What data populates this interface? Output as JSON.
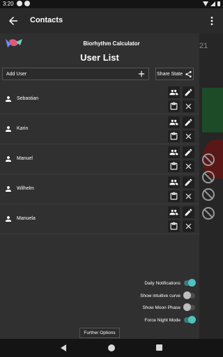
{
  "status_bar": {
    "time": "3:20"
  },
  "app_bar": {
    "title": "Contacts"
  },
  "background": {
    "date_fragment": "21"
  },
  "drawer": {
    "app_name": "Biorhythm Calculator",
    "list_title": "User List",
    "add_user_label": "Add User",
    "share_label": "Share State",
    "users": [
      {
        "name": "Sebastian"
      },
      {
        "name": "Karin"
      },
      {
        "name": "Manuel"
      },
      {
        "name": "Wilhelm"
      },
      {
        "name": "Manuela"
      }
    ],
    "settings": [
      {
        "label": "Daily Notifications",
        "on": true
      },
      {
        "label": "Show intuitive curve",
        "on": false
      },
      {
        "label": "Show Moon Phase",
        "on": false
      },
      {
        "label": "Force Night Mode",
        "on": true
      }
    ],
    "further_options_label": "Further Options"
  },
  "colors": {
    "accent": "#4fc3c0",
    "surface": "#303030",
    "appbar": "#2a2a2a"
  }
}
